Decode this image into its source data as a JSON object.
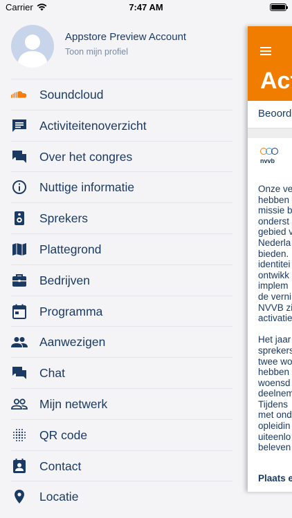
{
  "status_bar": {
    "carrier": "Carrier",
    "time": "7:47 AM"
  },
  "profile": {
    "name": "Appstore Preview Account",
    "link": "Toon mijn profiel"
  },
  "menu": [
    {
      "label": "Soundcloud",
      "icon": "soundcloud-icon",
      "color": "#f57d0c"
    },
    {
      "label": "Activiteitenoverzicht",
      "icon": "list-icon"
    },
    {
      "label": "Over het congres",
      "icon": "chat-bubble-icon"
    },
    {
      "label": "Nuttige informatie",
      "icon": "info-icon"
    },
    {
      "label": "Sprekers",
      "icon": "speaker-icon"
    },
    {
      "label": "Plattegrond",
      "icon": "map-icon"
    },
    {
      "label": "Bedrijven",
      "icon": "briefcase-icon"
    },
    {
      "label": "Programma",
      "icon": "calendar-icon"
    },
    {
      "label": "Aanwezigen",
      "icon": "people-icon"
    },
    {
      "label": "Chat",
      "icon": "chat-icon"
    },
    {
      "label": "Mijn netwerk",
      "icon": "network-icon"
    },
    {
      "label": "QR code",
      "icon": "qr-icon"
    },
    {
      "label": "Contact",
      "icon": "contact-icon"
    },
    {
      "label": "Locatie",
      "icon": "location-icon"
    }
  ],
  "behind": {
    "header_title": "Act",
    "tab_label": "Beoord",
    "logo_text": "nvvb",
    "body": "Onze ve\nhebben\nmissie b\nonderst\ngebied v\nNederla\nbieden.\nidentitei\nontwikk\nimplem\nde verni\nNVVB zi\nactivatie\n\nHet jaar\nsprekers\ntwee wo\nhebben\nwoensd\ndeelnem\nTijdens\nmet ond\nopleidin\nuiteenlo\nbeleven",
    "footer_link": "Plaats e"
  },
  "colors": {
    "accent": "#f07d00",
    "text": "#1b3a63",
    "drawer_bg": "#f4f4f6"
  }
}
